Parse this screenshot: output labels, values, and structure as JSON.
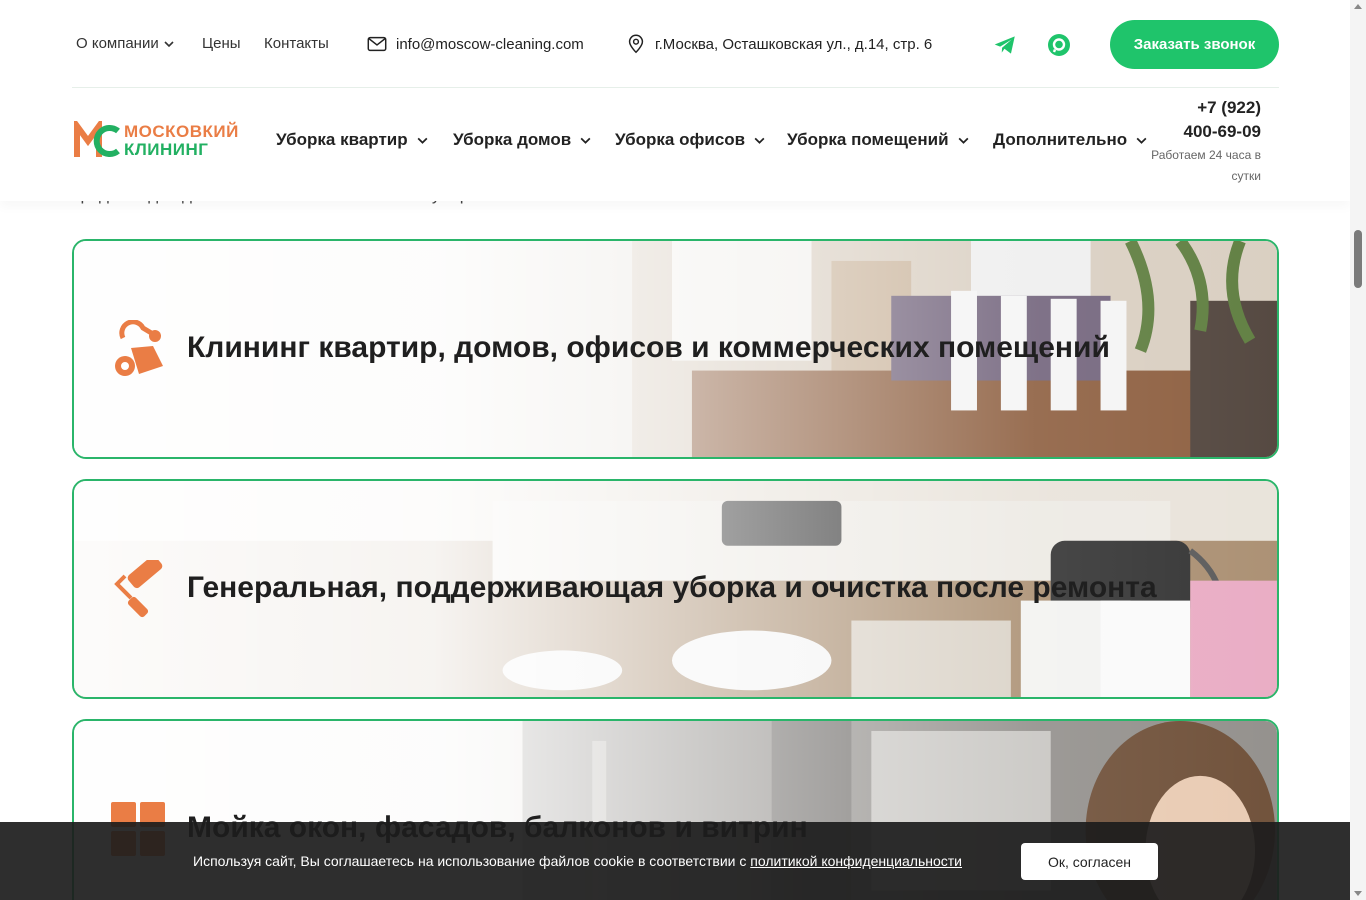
{
  "topbar": {
    "links": [
      {
        "label": "О компании",
        "has_dropdown": true
      },
      {
        "label": "Цены",
        "has_dropdown": false
      },
      {
        "label": "Контакты",
        "has_dropdown": false
      }
    ],
    "email": "info@moscow-cleaning.com",
    "address": "г.Москва, Осташковская ул., д.14, стр. 6",
    "icons": [
      "telegram-icon",
      "max-messenger-icon"
    ],
    "call_button": "Заказать звонок",
    "accent_color": "#1fc46b"
  },
  "logo": {
    "line1": "МОСКОВКИЙ",
    "line2": "КЛИНИНГ",
    "orange": "#ea7d45",
    "green": "#22b062"
  },
  "nav": {
    "items": [
      {
        "label": "Уборка квартир"
      },
      {
        "label": "Уборка домов"
      },
      {
        "label": "Уборка офисов"
      },
      {
        "label": "Уборка помещений"
      },
      {
        "label": "Дополнительно"
      }
    ]
  },
  "phone": {
    "line1": "+7 (922)",
    "line2": "400-69-09",
    "hours": "Работаем 24 часа в сутки"
  },
  "clipped_text": "средства для достижения высокого качества уборки.",
  "services": [
    {
      "title": "Клининг квартир, домов, офисов и коммерческих помещений",
      "icon": "vacuum-cleaner-icon"
    },
    {
      "title": "Генеральная, поддерживающая уборка и очистка после ремонта",
      "icon": "paint-roller-icon"
    },
    {
      "title": "Мойка окон, фасадов, балконов и витрин",
      "icon": "window-icon"
    }
  ],
  "cookie": {
    "message": "Используя сайт, Вы соглашаетесь на использование файлов cookie в соответствии с",
    "link": "политикой конфиденциальности",
    "button": "Ок, согласен"
  }
}
